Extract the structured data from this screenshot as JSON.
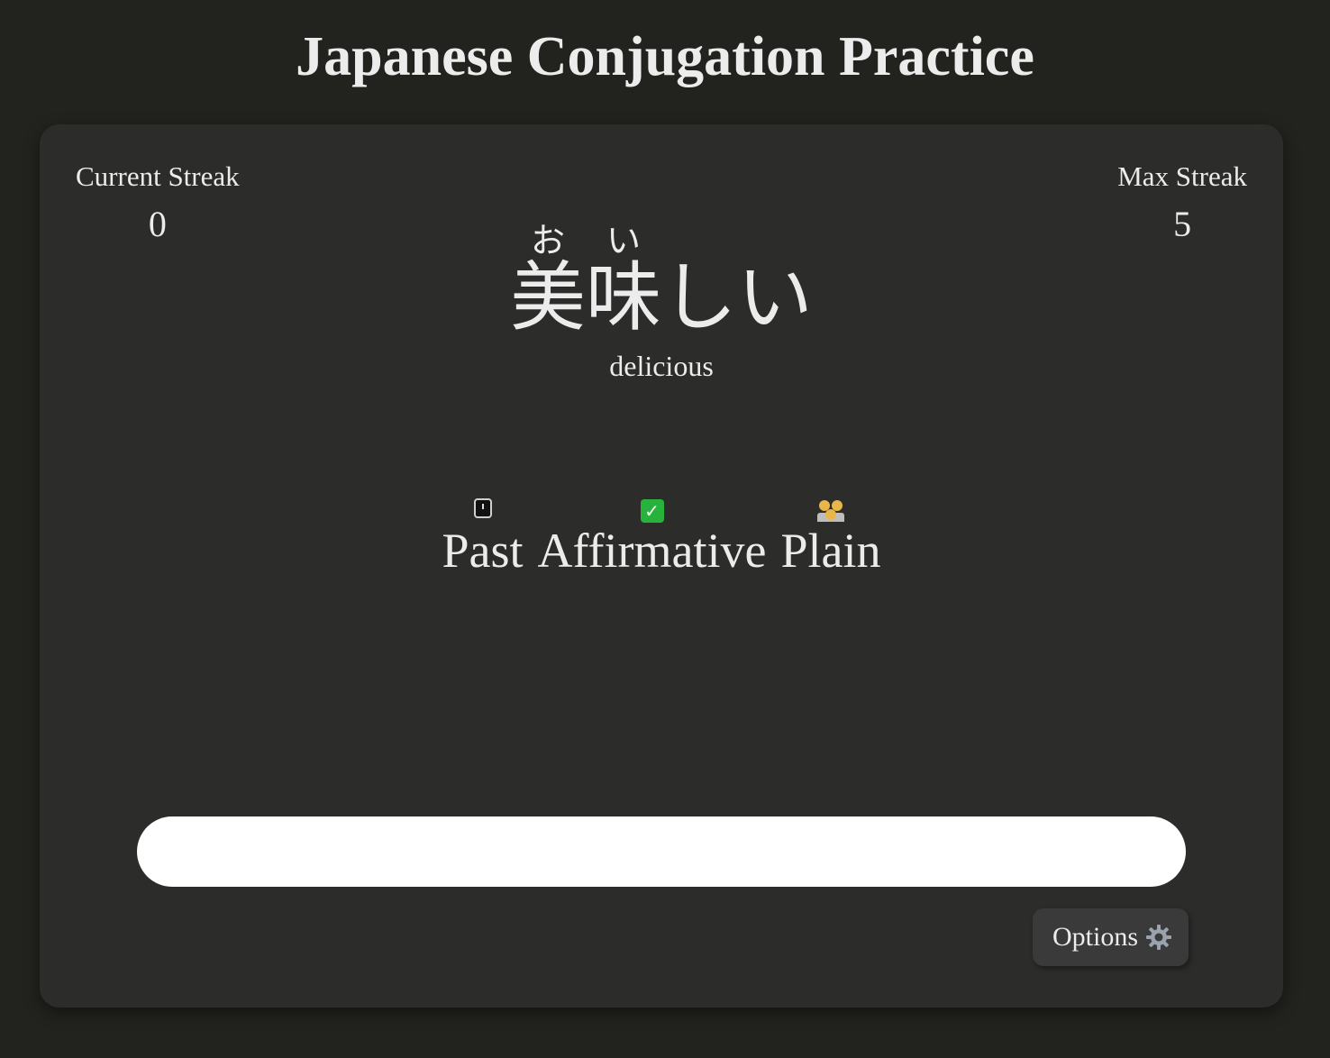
{
  "header": {
    "title": "Japanese Conjugation Practice"
  },
  "stats": {
    "current_streak_label": "Current Streak",
    "current_streak_value": "0",
    "max_streak_label": "Max Streak",
    "max_streak_value": "5"
  },
  "word": {
    "kanji1": "美",
    "furigana1": "お",
    "kanji2": "味",
    "furigana2": "い",
    "okurigana": "しい",
    "meaning": "delicious"
  },
  "conjugation": {
    "tense": "Past",
    "tense_icon": "stopwatch-icon",
    "polarity": "Affirmative",
    "polarity_icon": "check-mark-icon",
    "formality": "Plain",
    "formality_icon": "people-icon"
  },
  "answer": {
    "value": "",
    "placeholder": ""
  },
  "options": {
    "label": "Options",
    "icon": "gear-icon"
  },
  "colors": {
    "background": "#22231f",
    "card": "#2c2c2b",
    "text": "#ececec",
    "input": "#ffffff",
    "button": "#3a3a3a",
    "check": "#27b33b"
  }
}
